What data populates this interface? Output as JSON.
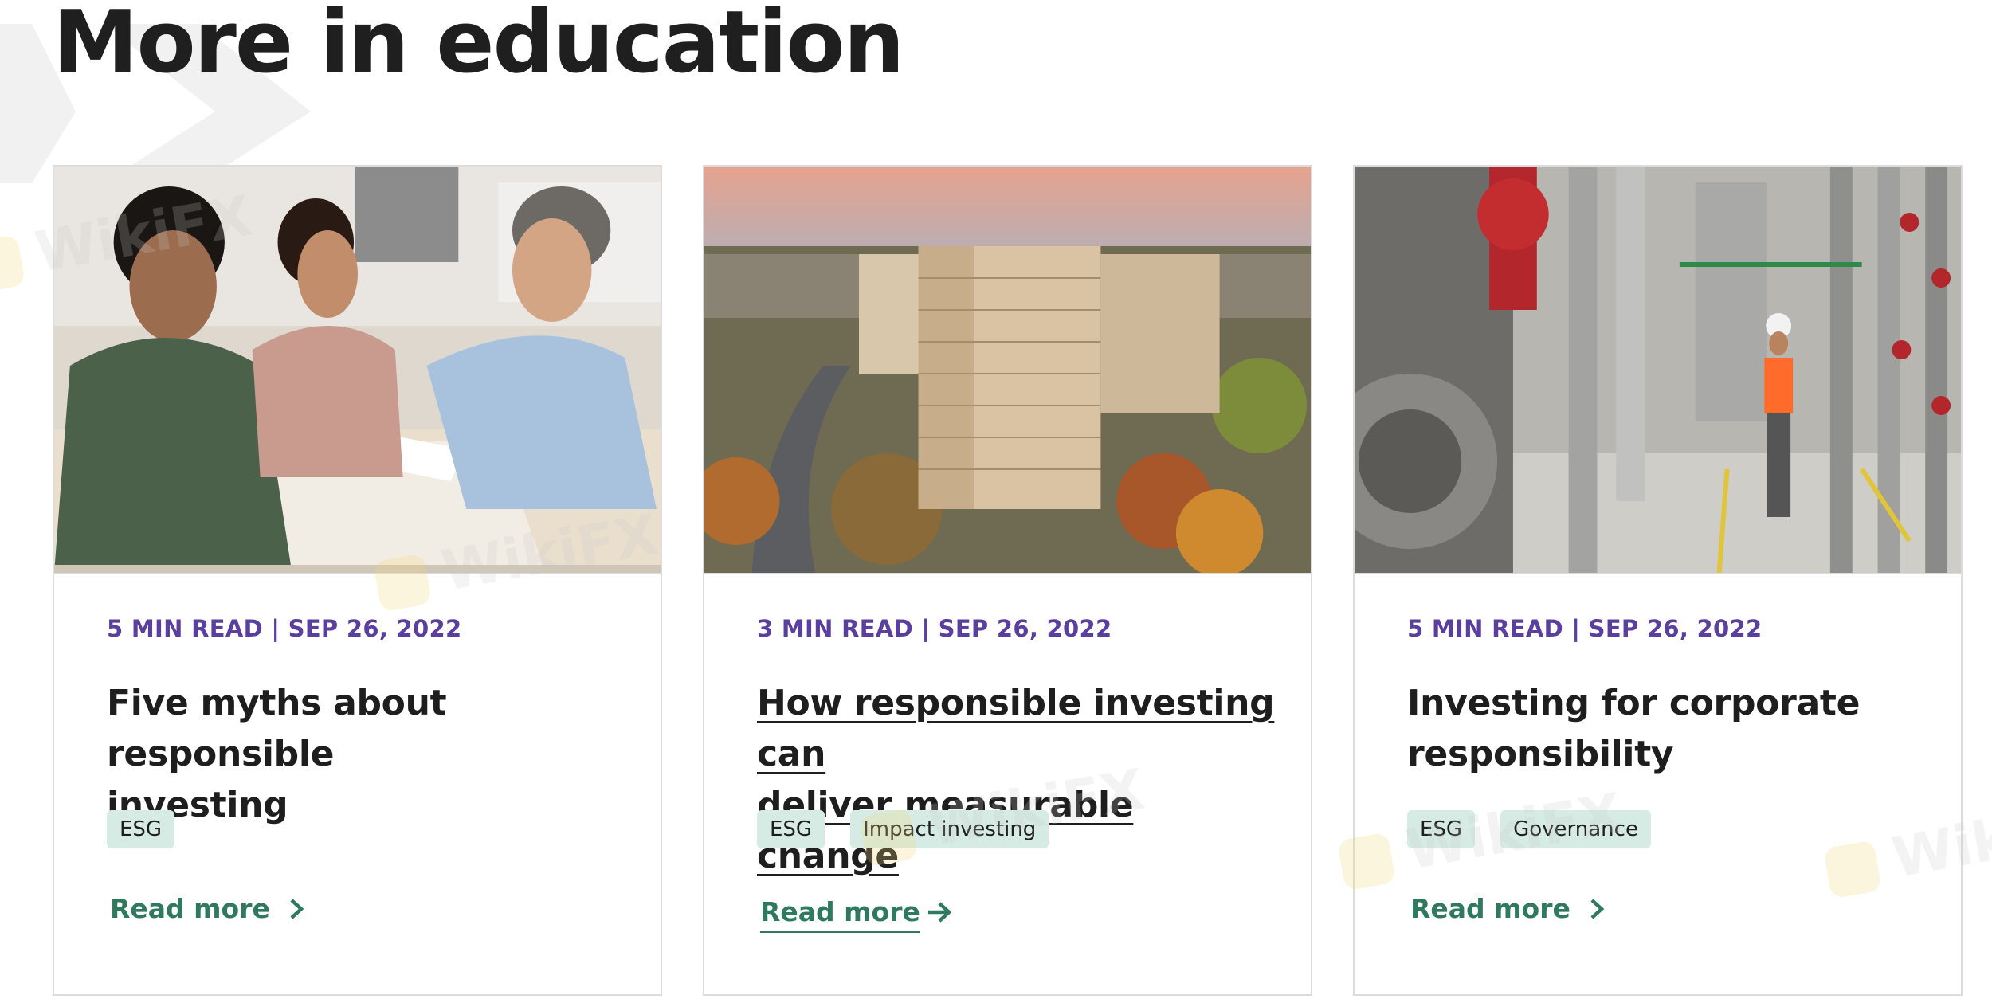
{
  "section": {
    "title": "More in education"
  },
  "cards": [
    {
      "meta": "5 MIN READ | SEP 26, 2022",
      "headline_line1": "Five myths about responsible",
      "headline_line2": "investing",
      "tags": [
        "ESG"
      ],
      "read_more": "Read more",
      "image_alt": "couple-meeting-advisor-photo"
    },
    {
      "meta": "3 MIN READ | SEP 26, 2022",
      "headline_line1": "How responsible investing can",
      "headline_line2": "deliver measurable change",
      "tags": [
        "ESG",
        "Impact investing"
      ],
      "read_more": "Read more",
      "image_alt": "apartment-towers-aerial-photo"
    },
    {
      "meta": "5 MIN READ | SEP 26, 2022",
      "headline_line1": "Investing for corporate",
      "headline_line2": "responsibility",
      "tags": [
        "ESG",
        "Governance"
      ],
      "read_more": "Read more",
      "image_alt": "industrial-plant-worker-photo"
    }
  ],
  "watermark": {
    "text": "WikiFX"
  },
  "colors": {
    "meta": "#5a3f9e",
    "link": "#2f7a5e",
    "tag_bg": "#d7ebe5",
    "heading": "#1f1f1f"
  }
}
